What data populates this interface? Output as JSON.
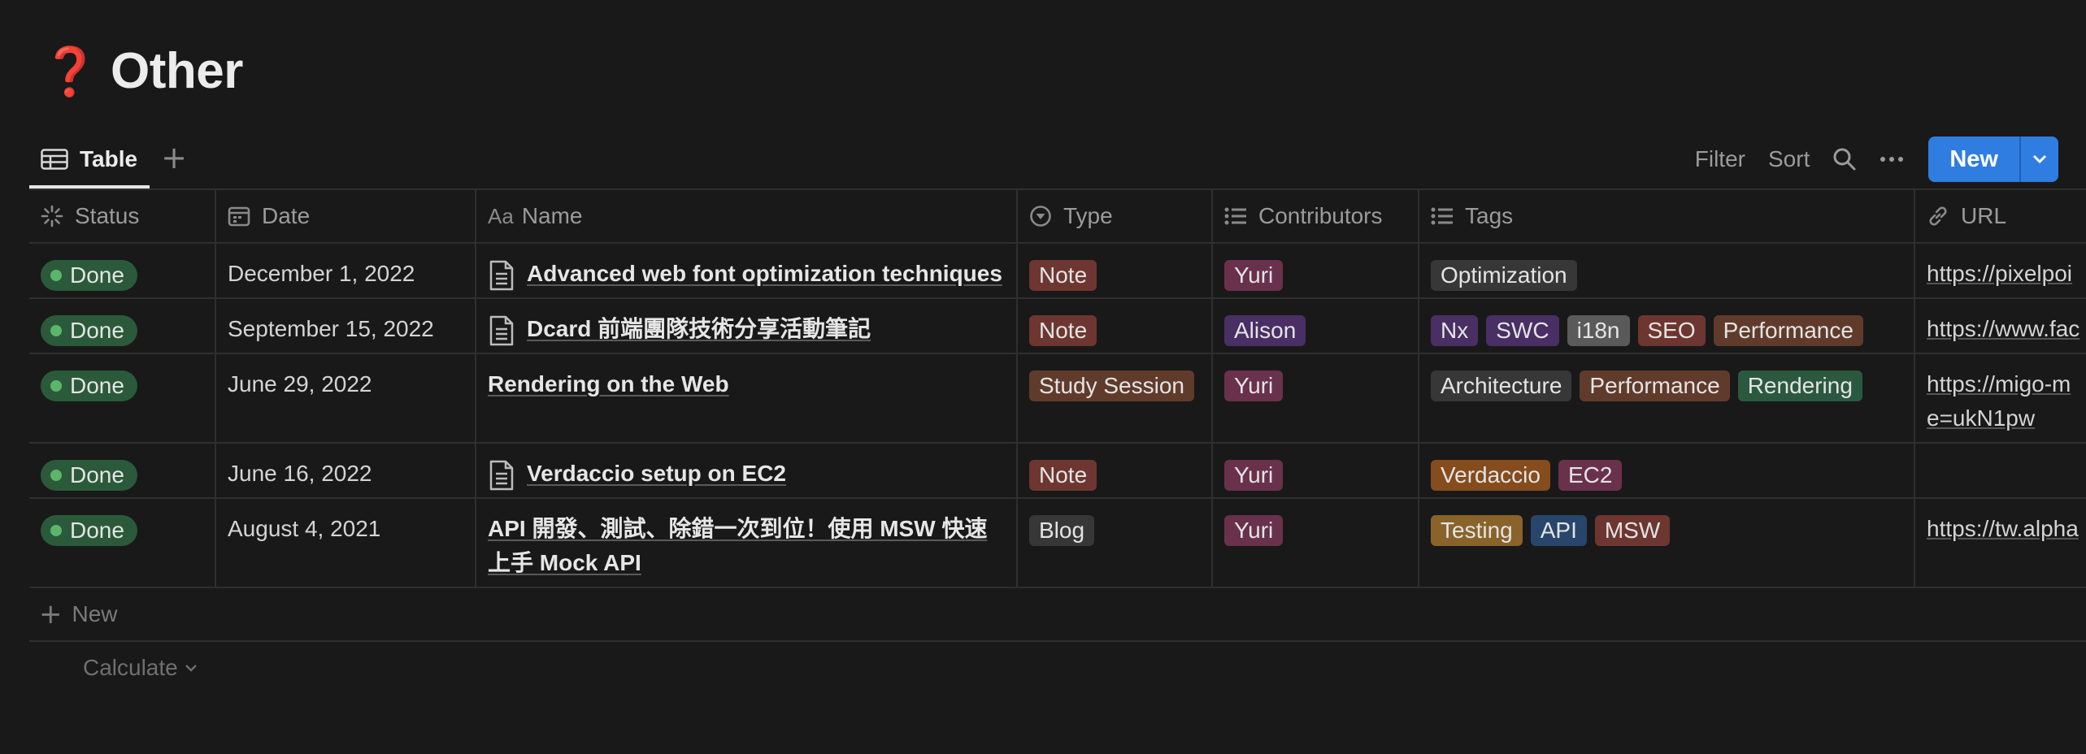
{
  "page": {
    "emoji": "❓",
    "title": "Other"
  },
  "view": {
    "tab_label": "Table",
    "add_view_label": "+"
  },
  "toolbar": {
    "filter": "Filter",
    "sort": "Sort",
    "new_label": "New"
  },
  "columns": [
    {
      "label": "Status",
      "icon": "loader-icon"
    },
    {
      "label": "Date",
      "icon": "calendar-icon"
    },
    {
      "label": "Name",
      "icon_text": "Aa"
    },
    {
      "label": "Type",
      "icon": "select-icon"
    },
    {
      "label": "Contributors",
      "icon": "list-icon"
    },
    {
      "label": "Tags",
      "icon": "list-icon"
    },
    {
      "label": "URL",
      "icon": "link-icon"
    }
  ],
  "rows": [
    {
      "status": "Done",
      "date": "December 1, 2022",
      "name": "Advanced web font optimization techniques",
      "has_page_icon": true,
      "type": {
        "label": "Note",
        "color": "#6e3630"
      },
      "contributor": {
        "label": "Yuri",
        "color": "#69314c"
      },
      "tags": [
        {
          "label": "Optimization",
          "color": "#373737"
        }
      ],
      "url": "https://pixelpoi"
    },
    {
      "status": "Done",
      "date": "September 15, 2022",
      "name": "Dcard 前端團隊技術分享活動筆記",
      "has_page_icon": true,
      "type": {
        "label": "Note",
        "color": "#6e3630"
      },
      "contributor": {
        "label": "Alison",
        "color": "#492f64"
      },
      "tags": [
        {
          "label": "Nx",
          "color": "#492f64"
        },
        {
          "label": "SWC",
          "color": "#492f64"
        },
        {
          "label": "i18n",
          "color": "#5a5a5a"
        },
        {
          "label": "SEO",
          "color": "#6e3630"
        },
        {
          "label": "Performance",
          "color": "#603b2c"
        }
      ],
      "url": "https://www.fac"
    },
    {
      "status": "Done",
      "date": "June 29, 2022",
      "name": "Rendering on the Web",
      "has_page_icon": false,
      "type": {
        "label": "Study Session",
        "color": "#603b2c"
      },
      "contributor": {
        "label": "Yuri",
        "color": "#69314c"
      },
      "tags": [
        {
          "label": "Architecture",
          "color": "#373737"
        },
        {
          "label": "Performance",
          "color": "#603b2c"
        },
        {
          "label": "Rendering",
          "color": "#2b593f"
        }
      ],
      "url": "https://migo-m",
      "url_line2": "e=ukN1pw"
    },
    {
      "status": "Done",
      "date": "June 16, 2022",
      "name": "Verdaccio setup on EC2",
      "has_page_icon": true,
      "type": {
        "label": "Note",
        "color": "#6e3630"
      },
      "contributor": {
        "label": "Yuri",
        "color": "#69314c"
      },
      "tags": [
        {
          "label": "Verdaccio",
          "color": "#854c1d"
        },
        {
          "label": "EC2",
          "color": "#69314c"
        }
      ],
      "url": ""
    },
    {
      "status": "Done",
      "date": "August 4, 2021",
      "name": "API 開發、測試、除錯一次到位！使用 MSW 快速",
      "name_line2": "上手 Mock API",
      "has_page_icon": false,
      "type": {
        "label": "Blog",
        "color": "#373737"
      },
      "contributor": {
        "label": "Yuri",
        "color": "#69314c"
      },
      "tags": [
        {
          "label": "Testing",
          "color": "#89632a"
        },
        {
          "label": "API",
          "color": "#28456c"
        },
        {
          "label": "MSW",
          "color": "#6e3630"
        }
      ],
      "url": "https://tw.alpha"
    }
  ],
  "footer": {
    "new_label": "New",
    "calculate_label": "Calculate"
  }
}
